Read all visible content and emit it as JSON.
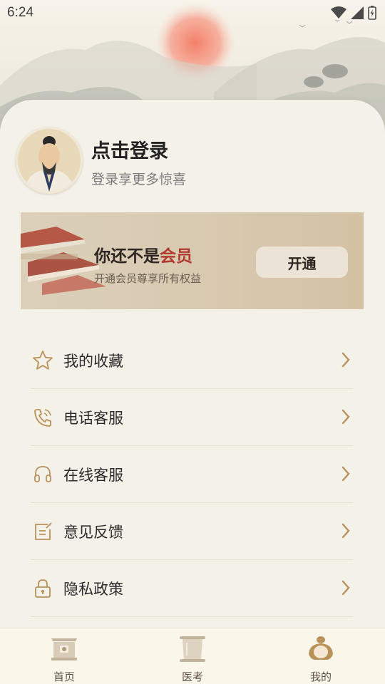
{
  "status_bar": {
    "time": "6:24"
  },
  "profile": {
    "title": "点击登录",
    "subtitle": "登录享更多惊喜"
  },
  "vip": {
    "title_prefix": "你还不是",
    "title_highlight": "会员",
    "subtitle": "开通会员尊享所有权益",
    "button_label": "开通"
  },
  "menu": {
    "items": [
      {
        "label": "我的收藏",
        "icon": "star-icon"
      },
      {
        "label": "电话客服",
        "icon": "phone-icon"
      },
      {
        "label": "在线客服",
        "icon": "headset-icon"
      },
      {
        "label": "意见反馈",
        "icon": "feedback-icon"
      },
      {
        "label": "隐私政策",
        "icon": "lock-icon"
      }
    ]
  },
  "bottom_nav": {
    "items": [
      {
        "label": "首页",
        "icon": "home-gate-icon"
      },
      {
        "label": "医考",
        "icon": "scroll-icon"
      },
      {
        "label": "我的",
        "icon": "scholar-icon"
      }
    ],
    "active_index": 2
  },
  "colors": {
    "accent": "#b8925a",
    "highlight": "#b03a2e",
    "background": "#f4f1e9"
  }
}
